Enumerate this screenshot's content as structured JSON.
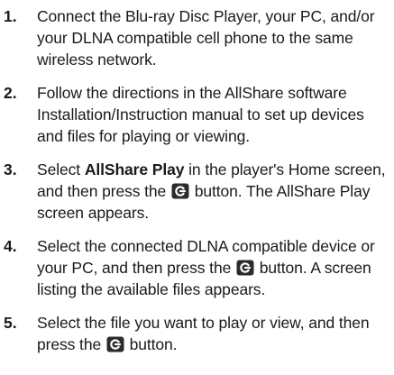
{
  "steps": [
    {
      "number": "1.",
      "text": "Connect the Blu-ray Disc Player, your PC, and/or your DLNA compatible cell phone to the same wireless network."
    },
    {
      "number": "2.",
      "text": "Follow the directions in the AllShare software Installation/Instruction manual to set up devices and files for playing or viewing."
    },
    {
      "number": "3.",
      "text_before": "Select ",
      "bold": "AllShare Play",
      "text_mid": " in the player's Home screen, and then press the ",
      "icon": "enter-button-icon",
      "text_after": " button. The AllShare Play screen appears."
    },
    {
      "number": "4.",
      "text_before": "Select the connected DLNA compatible device or your PC, and then press the ",
      "icon": "enter-button-icon",
      "text_after": " button. A screen listing the available files appears."
    },
    {
      "number": "5.",
      "text_before": "Select the file you want to play or view, and then press the ",
      "icon": "enter-button-icon",
      "text_after": " button."
    }
  ],
  "colors": {
    "text": "#1a1a1a",
    "icon_fill": "#2b2b2b"
  }
}
